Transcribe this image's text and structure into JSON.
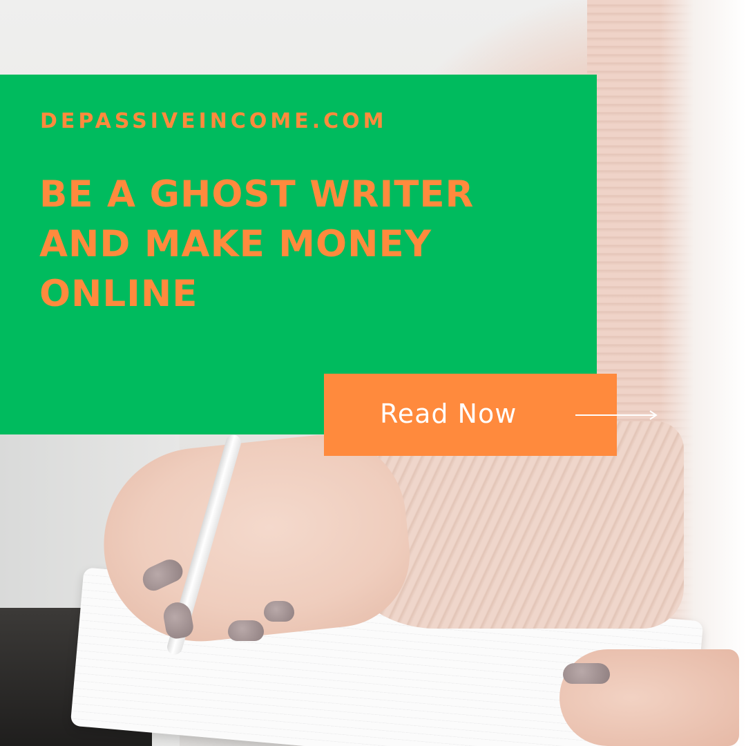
{
  "site": {
    "name": "DEPASSIVEINCOME.COM"
  },
  "headline": {
    "lines": [
      "BE A GHOST WRITER",
      "AND MAKE MONEY",
      "ONLINE"
    ]
  },
  "cta": {
    "label": "Read Now",
    "icon": "arrow-right-icon"
  },
  "colors": {
    "panel": "#00bb5e",
    "accent": "#ff8a3d",
    "cta_text": "#ffffff"
  }
}
